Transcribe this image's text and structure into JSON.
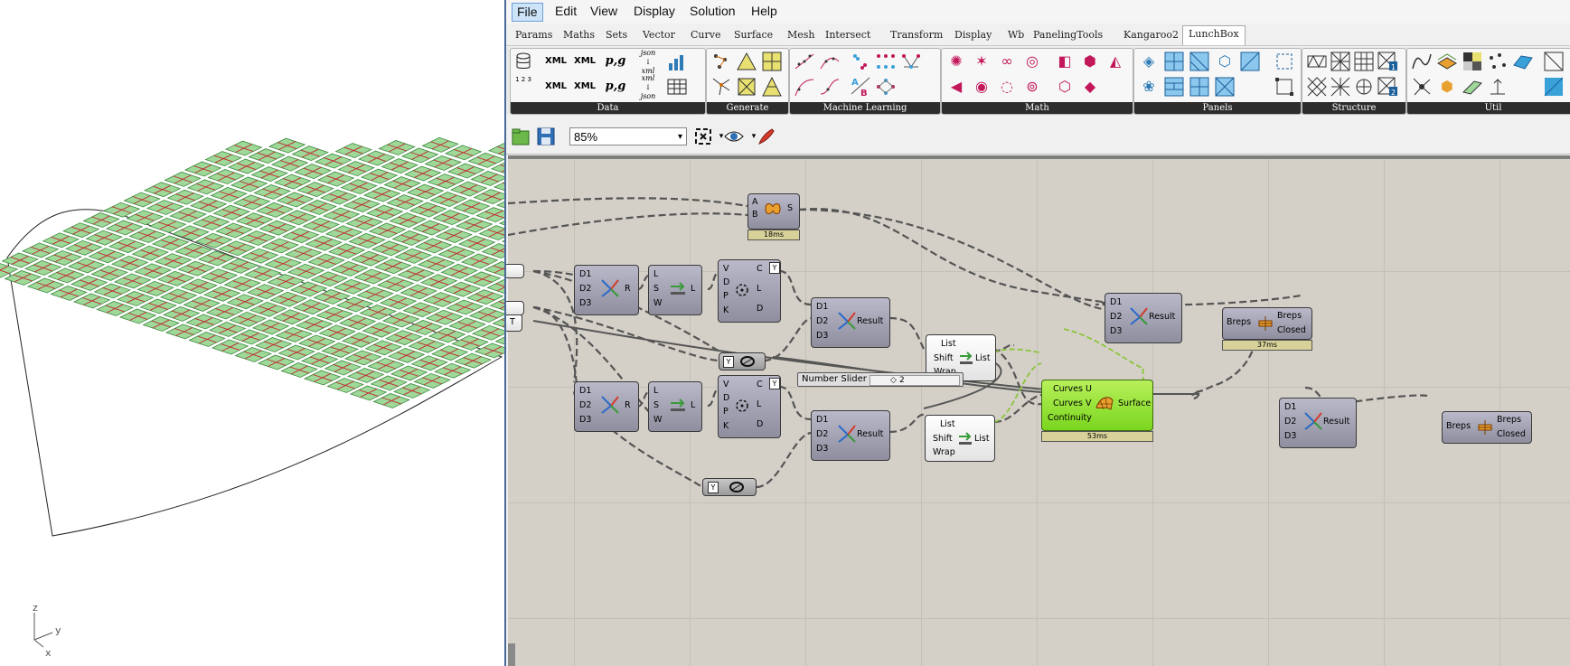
{
  "viewport": {
    "axes": {
      "z": "z",
      "y": "y",
      "x": "x"
    }
  },
  "menubar": {
    "items": [
      "File",
      "Edit",
      "View",
      "Display",
      "Solution",
      "Help"
    ],
    "active": "File"
  },
  "tabs": [
    "Params",
    "Maths",
    "Sets",
    "Vector",
    "Curve",
    "Surface",
    "Mesh",
    "Intersect",
    "Transform",
    "Display",
    "Wb",
    "PanelingTools",
    "Kangaroo2",
    "LunchBox"
  ],
  "active_tab": "LunchBox",
  "ribbon_groups": [
    "Data",
    "Generate",
    "Machine Learning",
    "Math",
    "Panels",
    "Structure",
    "Util"
  ],
  "ribbon_icons": {
    "xml1": "XML",
    "xml2": "XML",
    "xml3": "XML",
    "xml4": "XML",
    "pg1": "p,g",
    "pg2": "p,g",
    "json1": "json",
    "json1b": "xml",
    "json2": "xml",
    "json2b": "json",
    "num_col": "1 2 3"
  },
  "toolbar": {
    "zoom": "85%"
  },
  "components": {
    "merge_top": {
      "in": [
        "A",
        "B"
      ],
      "out": "S",
      "timer": "18ms"
    },
    "deconstruct1": {
      "in": [
        "D1",
        "D2",
        "D3"
      ],
      "out": "R"
    },
    "deconstruct2": {
      "in": [
        "D1",
        "D2",
        "D3"
      ],
      "out": "R"
    },
    "shift1": {
      "in": [
        "L",
        "S",
        "W"
      ],
      "out": "L"
    },
    "shift2": {
      "in": [
        "L",
        "S",
        "W"
      ],
      "out": "L"
    },
    "closest1": {
      "in": [
        "V",
        "D",
        "P",
        "K"
      ],
      "out": [
        "C",
        "L",
        "D"
      ]
    },
    "closest2": {
      "in": [
        "V",
        "D",
        "P",
        "K"
      ],
      "out": [
        "C",
        "L",
        "D"
      ]
    },
    "merge1": {
      "in": [
        "D1",
        "D2",
        "D3"
      ],
      "out": "Result"
    },
    "merge2": {
      "in": [
        "D1",
        "D2",
        "D3"
      ],
      "out": "Result"
    },
    "merge3": {
      "in": [
        "D1",
        "D2",
        "D3"
      ],
      "out": "Result"
    },
    "merge4": {
      "in": [
        "D1",
        "D2",
        "D3"
      ],
      "out": "Result"
    },
    "list_shift1": {
      "in": [
        "List",
        "Shift",
        "Wrap"
      ],
      "out": "List"
    },
    "list_shift2": {
      "in": [
        "List",
        "Shift",
        "Wrap"
      ],
      "out": "List"
    },
    "network_srf": {
      "in": [
        "Curves U",
        "Curves V",
        "Continuity"
      ],
      "out": "Surface",
      "timer": "53ms"
    },
    "cap1": {
      "in": [
        "Breps"
      ],
      "out": [
        "Breps",
        "Closed"
      ],
      "timer": "37ms"
    },
    "cap2": {
      "in": [
        "Breps"
      ],
      "out": [
        "Breps",
        "Closed"
      ]
    },
    "slider": {
      "label": "Number Slider",
      "value": "2"
    },
    "param_t": {
      "label": "T"
    }
  },
  "colors": {
    "panel_fill": "#9fd99a",
    "panel_stroke": "#3f8a3f",
    "panel_rib": "#c1272d",
    "gh_canvas": "#d4d0c8",
    "component_green": "#8ee23a"
  }
}
